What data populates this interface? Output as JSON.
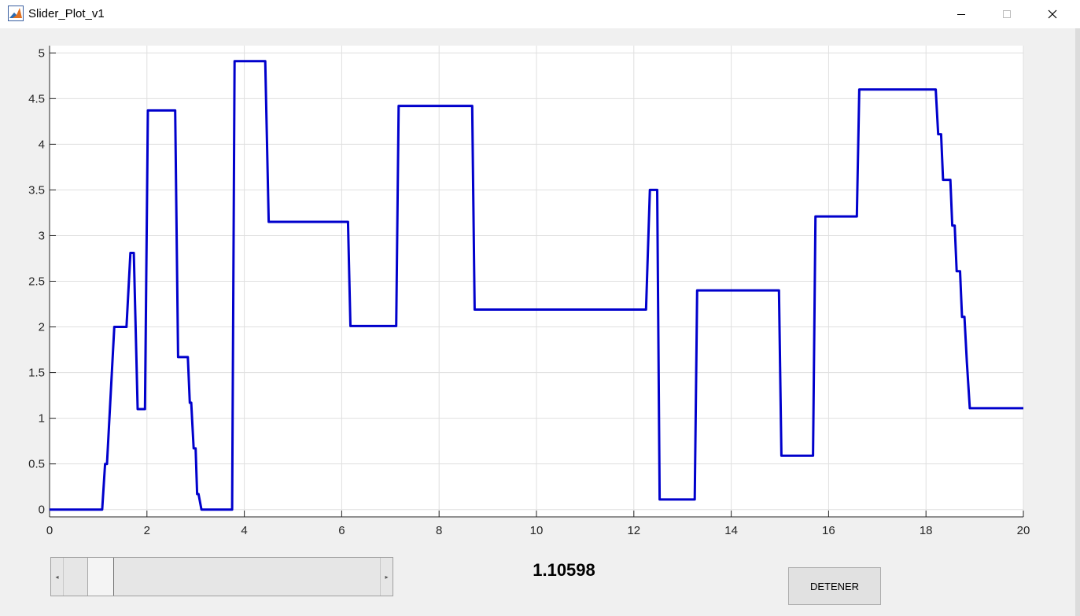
{
  "window": {
    "title": "Slider_Plot_v1"
  },
  "slider": {
    "min": 0,
    "max": 20,
    "value": 1.7,
    "value_fraction": 0.085
  },
  "readout": {
    "value": "1.10598"
  },
  "stop_button": {
    "label": "DETENER"
  },
  "chart_data": {
    "type": "line",
    "title": "",
    "xlabel": "",
    "ylabel": "",
    "xlim": [
      0,
      20
    ],
    "ylim": [
      -0.08,
      5.08
    ],
    "grid": true,
    "x_ticks": [
      0,
      2,
      4,
      6,
      8,
      10,
      12,
      14,
      16,
      18,
      20
    ],
    "x_tick_labels": [
      "0",
      "2",
      "4",
      "6",
      "8",
      "10",
      "12",
      "14",
      "16",
      "18",
      "20"
    ],
    "y_ticks": [
      0,
      0.5,
      1,
      1.5,
      2,
      2.5,
      3,
      3.5,
      4,
      4.5,
      5
    ],
    "y_tick_labels": [
      "0",
      "0.5",
      "1",
      "1.5",
      "2",
      "2.5",
      "3",
      "3.5",
      "4",
      "4.5",
      "5"
    ],
    "series": [
      {
        "color": "#0000cc",
        "x": [
          0,
          1.08,
          1.14,
          1.18,
          1.23,
          1.33,
          1.58,
          1.66,
          1.73,
          1.81,
          1.86,
          1.96,
          2.02,
          2.06,
          2.58,
          2.64,
          2.84,
          2.88,
          2.91,
          2.96,
          3.0,
          3.03,
          3.06,
          3.12,
          3.75,
          3.8,
          3.84,
          4.43,
          4.5,
          6.13,
          6.18,
          7.12,
          7.17,
          8.68,
          8.73,
          12.25,
          12.33,
          12.48,
          12.53,
          13.25,
          13.3,
          14.98,
          15.03,
          15.68,
          15.73,
          16.58,
          16.63,
          18.2,
          18.25,
          18.31,
          18.35,
          18.5,
          18.54,
          18.59,
          18.63,
          18.7,
          18.74,
          18.79,
          18.84,
          18.9,
          20
        ],
        "y": [
          0,
          0,
          0.5,
          0.5,
          1.0,
          2.0,
          2.0,
          2.81,
          2.81,
          1.1,
          1.1,
          1.1,
          4.37,
          4.37,
          4.37,
          1.67,
          1.67,
          1.17,
          1.17,
          0.67,
          0.67,
          0.17,
          0.17,
          0,
          0,
          4.91,
          4.91,
          4.91,
          3.15,
          3.15,
          2.01,
          2.01,
          4.42,
          4.42,
          2.19,
          2.19,
          3.5,
          3.5,
          0.11,
          0.11,
          2.4,
          2.4,
          0.59,
          0.59,
          3.21,
          3.21,
          4.6,
          4.6,
          4.11,
          4.11,
          3.61,
          3.61,
          3.11,
          3.11,
          2.61,
          2.61,
          2.11,
          2.11,
          1.61,
          1.11,
          1.11
        ]
      }
    ]
  }
}
